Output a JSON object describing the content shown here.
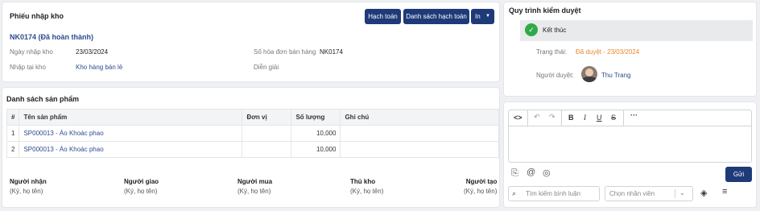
{
  "receipt": {
    "title": "Phiếu nhập kho",
    "buttons": {
      "accounting": "Hạch toán",
      "accounting_list": "Danh sách hạch toán",
      "print": "In"
    },
    "code": "NK0174 (Đã hoàn thành)",
    "date_label": "Ngày nhập kho",
    "date_value": "23/03/2024",
    "invoice_label": "Số hóa đơn bán hàng",
    "invoice_value": "NK0174",
    "warehouse_label": "Nhập tại kho",
    "warehouse_value": "Kho hàng bán lẻ",
    "note_label": "Diễn giải"
  },
  "products": {
    "title": "Danh sách sản phẩm",
    "columns": [
      "#",
      "Tên sản phẩm",
      "Đơn vị",
      "Số lượng",
      "Ghi chú"
    ],
    "rows": [
      {
        "index": "1",
        "name": "SP000013 - Áo Khoác phao",
        "unit": "",
        "quantity": "10,000",
        "note": ""
      },
      {
        "index": "2",
        "name": "SP000013 - Áo Khoác phao",
        "unit": "",
        "quantity": "10,000",
        "note": ""
      }
    ]
  },
  "signatures": [
    {
      "role": "Người nhận",
      "hint": "(Ký, họ tên)"
    },
    {
      "role": "Người giao",
      "hint": "(Ký, họ tên)"
    },
    {
      "role": "Người mua",
      "hint": "(Ký, họ tên)"
    },
    {
      "role": "Thủ kho",
      "hint": "(Ký, họ tên)"
    },
    {
      "role": "Người tạo",
      "hint": "(Ký, họ tên)"
    }
  ],
  "approval": {
    "title": "Quy trình kiểm duyệt",
    "step": "Kết thúc",
    "status_label": "Trạng thái:",
    "status_value": "Đã duyệt - 23/03/2024",
    "approver_label": "Người duyệt:",
    "approver_name": "Thu Trang"
  },
  "comment": {
    "send_label": "Gửi",
    "search_placeholder": "Tìm kiếm bình luận",
    "staff_placeholder": "Chọn nhân viên"
  },
  "colors": {
    "primary": "#1f3a78",
    "success": "#2eaa4a",
    "status": "#e8872a"
  }
}
